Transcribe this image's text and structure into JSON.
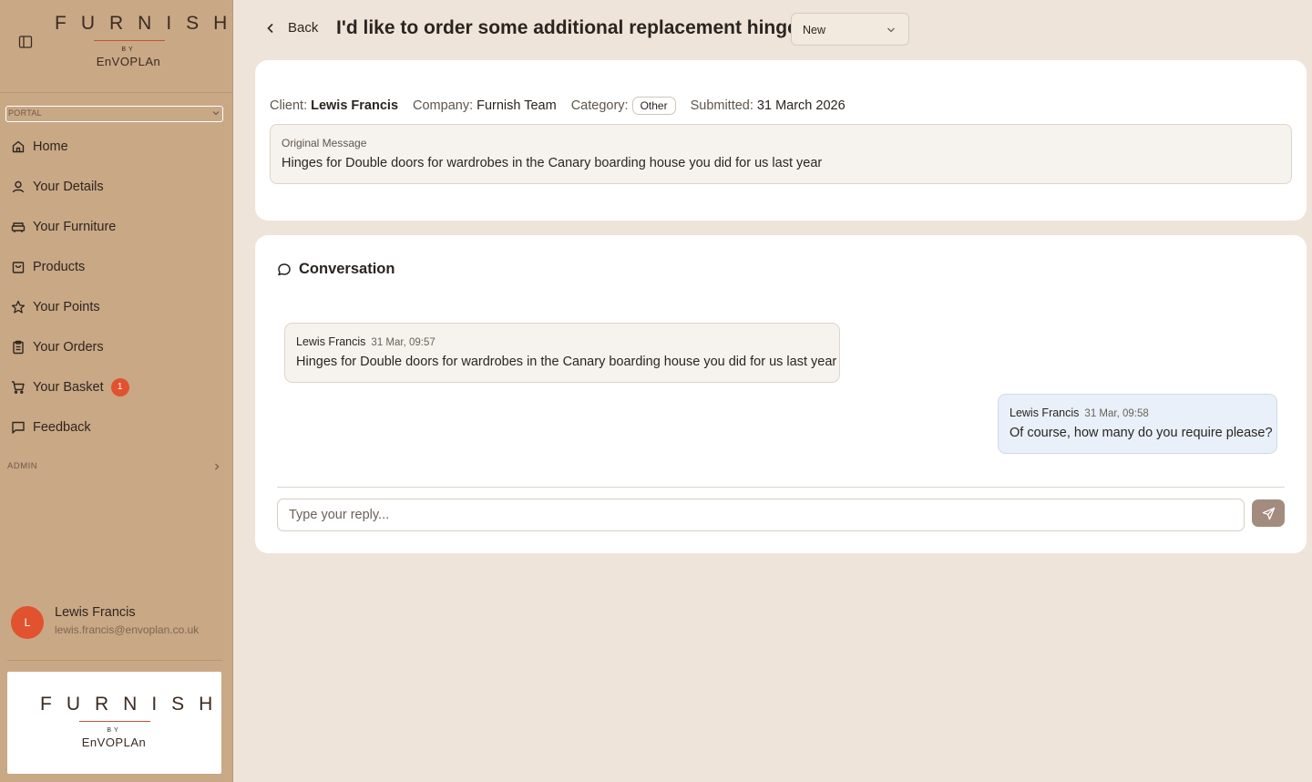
{
  "brand": {
    "wordmark": "FURNISH",
    "by": "BY",
    "sub": "EnVOPLAn"
  },
  "sidebar": {
    "portal_select": "PORTAL",
    "items": [
      {
        "label": "Home",
        "icon": "home-icon"
      },
      {
        "label": "Your Details",
        "icon": "user-icon"
      },
      {
        "label": "Your Furniture",
        "icon": "sofa-icon"
      },
      {
        "label": "Products",
        "icon": "shopping-bag-icon"
      },
      {
        "label": "Your Points",
        "icon": "star-icon"
      },
      {
        "label": "Your Orders",
        "icon": "clipboard-icon"
      },
      {
        "label": "Your Basket",
        "icon": "cart-icon",
        "badge": "1"
      },
      {
        "label": "Feedback",
        "icon": "message-square-icon"
      }
    ],
    "admin_label": "ADMIN",
    "user": {
      "initial": "L",
      "name": "Lewis Francis",
      "email": "lewis.francis@envoplan.co.uk"
    }
  },
  "header": {
    "back_label": "Back",
    "title": "I'd like to order some additional replacement hinges",
    "status": "New"
  },
  "details": {
    "client_label": "Client:",
    "client_value": "Lewis Francis",
    "company_label": "Company:",
    "company_value": "Furnish Team",
    "category_label": "Category:",
    "category_value": "Other",
    "submitted_label": "Submitted:",
    "submitted_value": "31 March 2026",
    "original_label": "Original Message",
    "original_text": "Hinges for Double doors for wardrobes in the Canary boarding house you did for us last year"
  },
  "conversation": {
    "title": "Conversation",
    "messages": [
      {
        "author": "Lewis Francis",
        "time": "31 Mar, 09:57",
        "text": "Hinges for Double doors for wardrobes in the Canary boarding house you did for us last year"
      },
      {
        "author": "Lewis Francis",
        "time": "31 Mar, 09:58",
        "text": "Of course, how many do you require please?"
      }
    ],
    "reply_placeholder": "Type your reply..."
  },
  "colors": {
    "sidebar_bg": "#c9a886",
    "page_bg": "#efe4d9",
    "accent": "#e1522f",
    "send_button": "#a38c7d",
    "own_message_bg": "#e9f0fa"
  }
}
